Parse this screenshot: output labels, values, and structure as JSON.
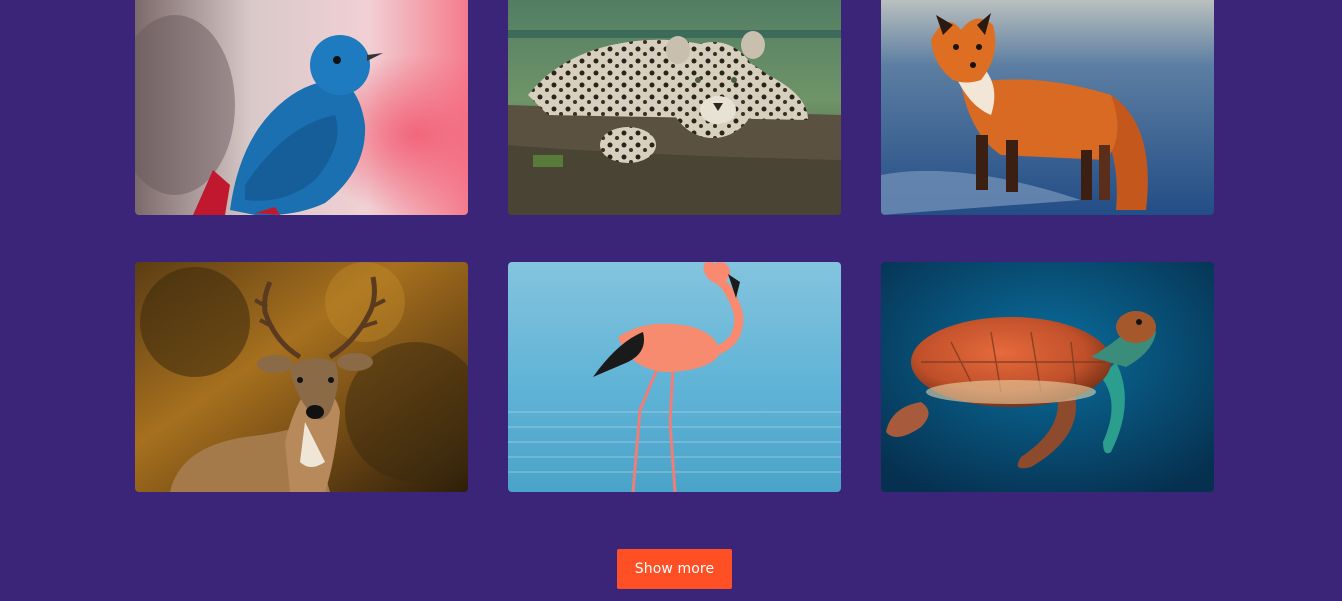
{
  "gallery": {
    "cards": [
      {
        "subject": "blue-bird"
      },
      {
        "subject": "leopard"
      },
      {
        "subject": "red-fox"
      },
      {
        "subject": "deer"
      },
      {
        "subject": "flamingo"
      },
      {
        "subject": "sea-turtle"
      }
    ]
  },
  "actions": {
    "show_more_label": "Show more"
  },
  "colors": {
    "page_background": "#3b2578",
    "button_accent": "#ff4f25",
    "button_text": "#ffffff"
  }
}
